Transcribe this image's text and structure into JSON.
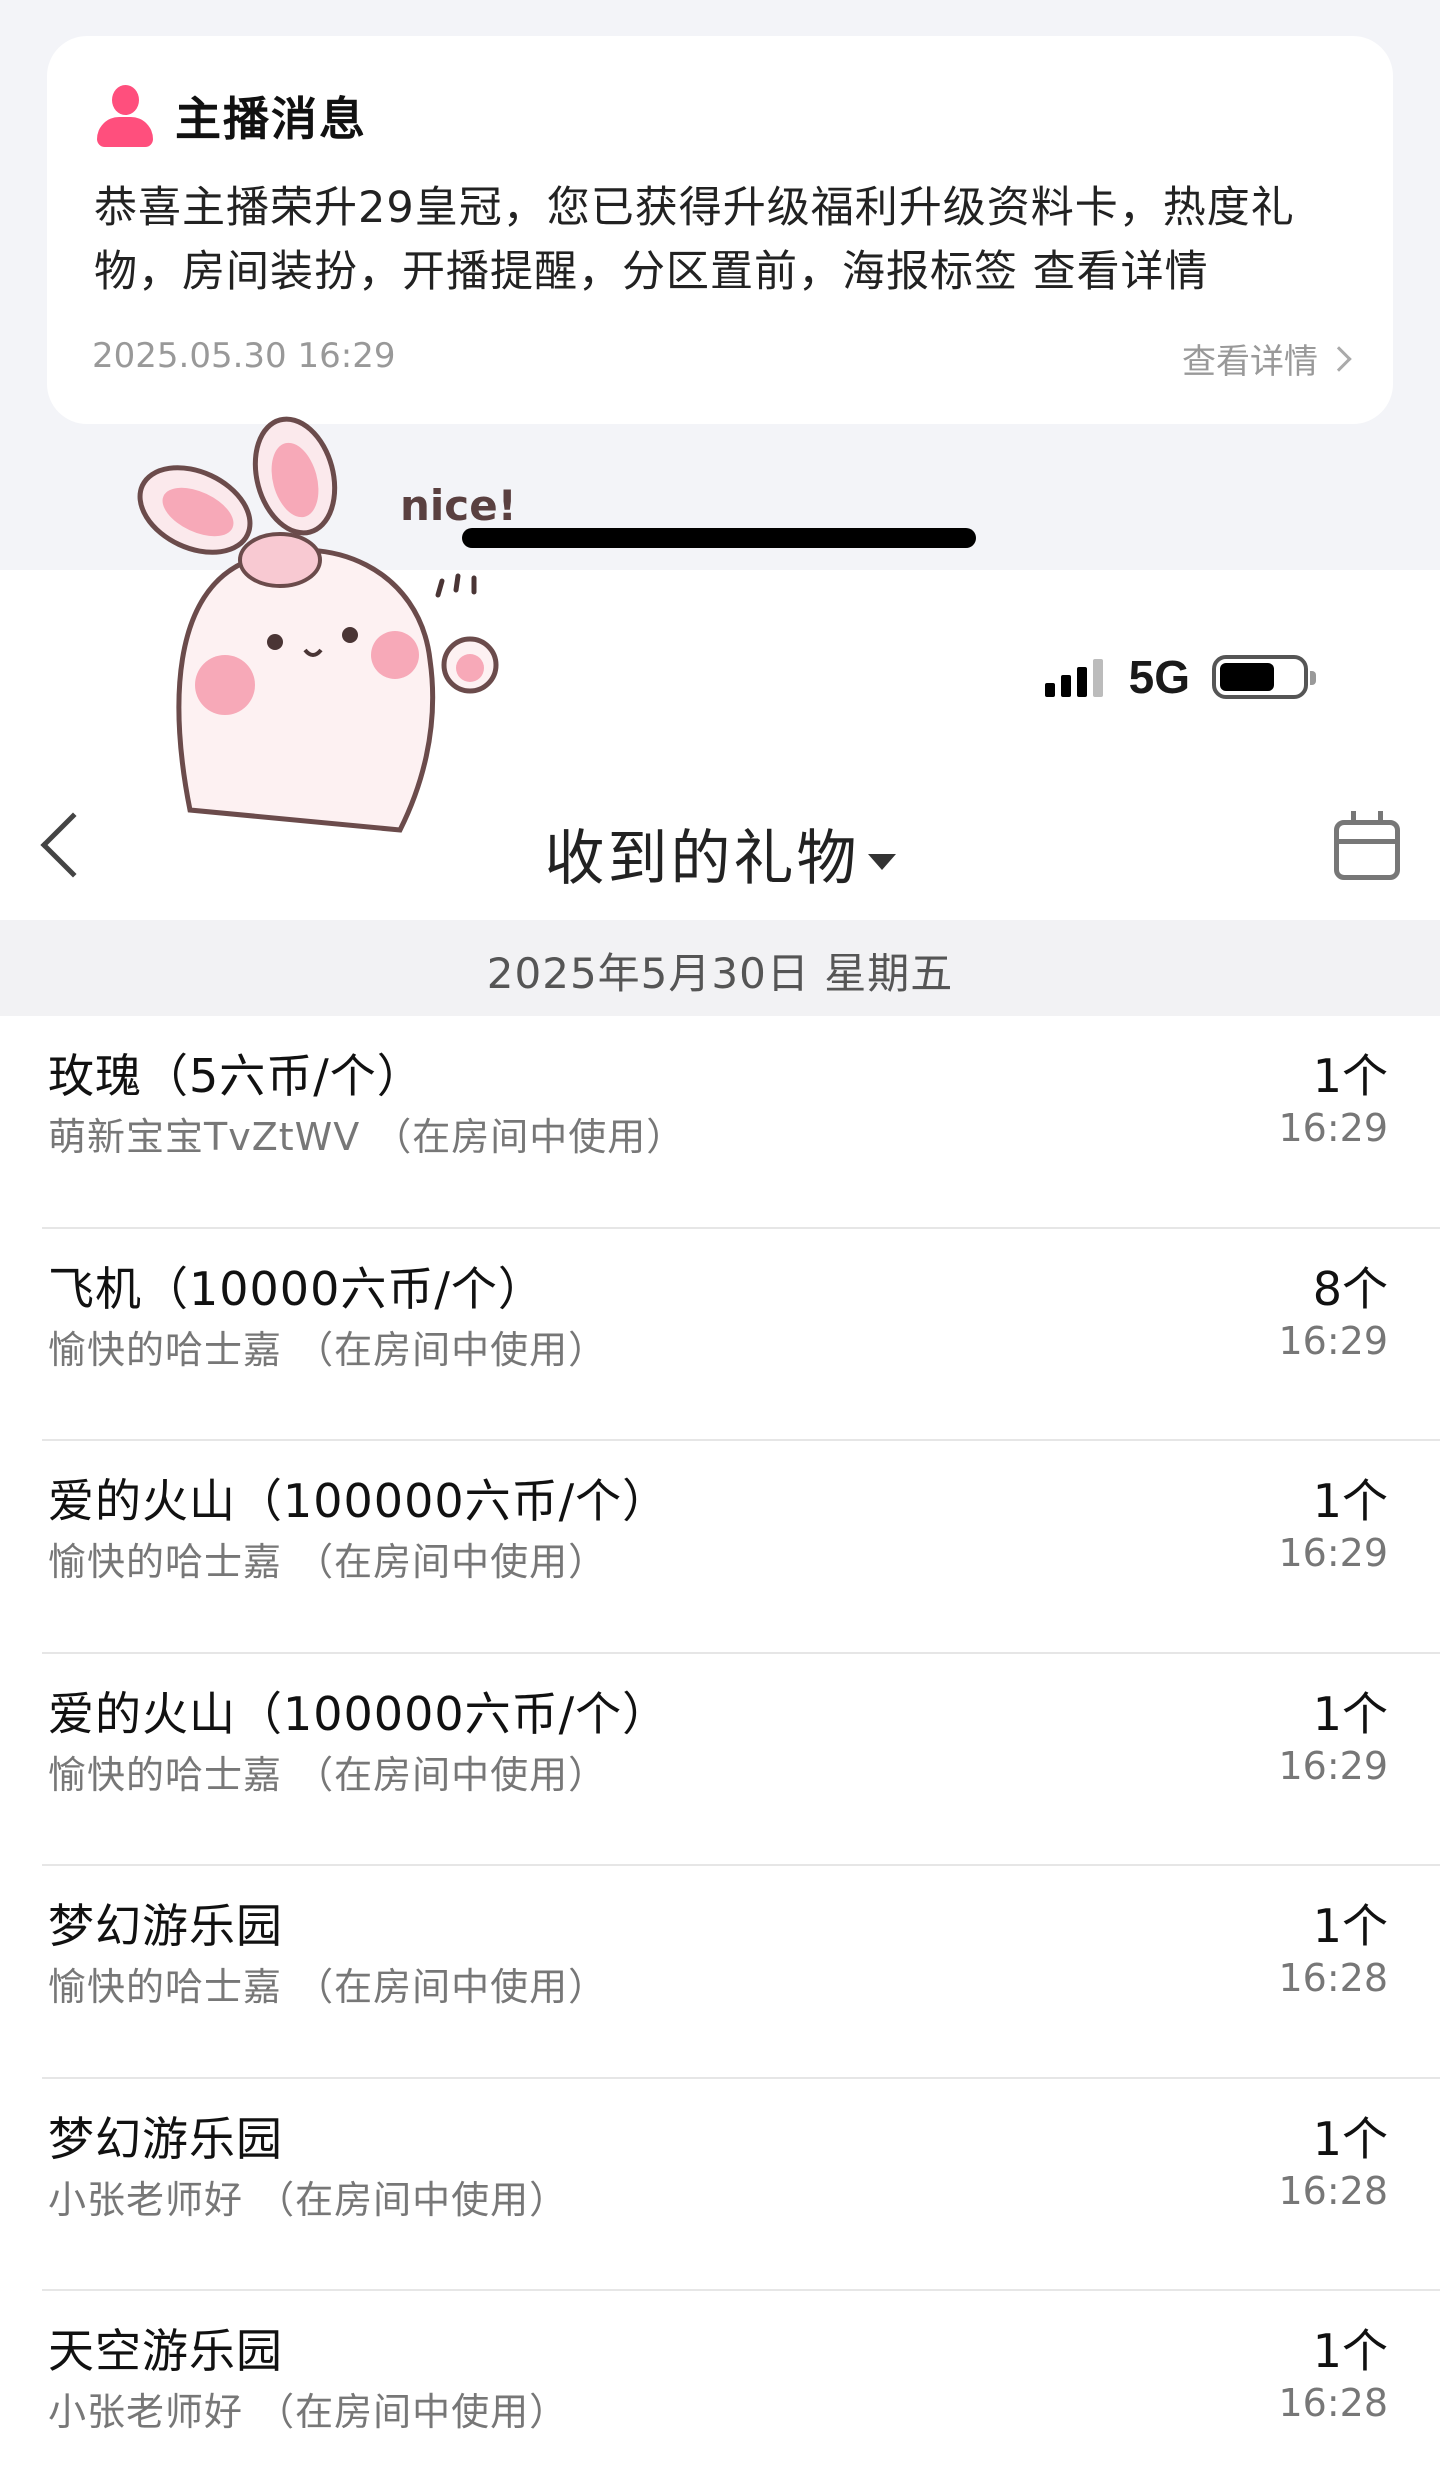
{
  "message": {
    "title": "主播消息",
    "body": "恭喜主播荣升29皇冠，您已获得升级福利升级资料卡，热度礼物，房间装扮，开播提醒，分区置前，海报标签 查看详情",
    "time": "2025.05.30 16:29",
    "detail_link": "查看详情"
  },
  "sticker": {
    "text": "nice!"
  },
  "status_bar": {
    "network": "5G"
  },
  "nav": {
    "title": "收到的礼物"
  },
  "date_header": "2025年5月30日 星期五",
  "gifts": [
    {
      "name": "玫瑰（5六币/个）",
      "sender": "萌新宝宝TvZtWV （在房间中使用）",
      "count": "1个",
      "time": "16:29"
    },
    {
      "name": "飞机（10000六币/个）",
      "sender": "愉快的哈士嘉 （在房间中使用）",
      "count": "8个",
      "time": "16:29"
    },
    {
      "name": "爱的火山（100000六币/个）",
      "sender": "愉快的哈士嘉 （在房间中使用）",
      "count": "1个",
      "time": "16:29"
    },
    {
      "name": "爱的火山（100000六币/个）",
      "sender": "愉快的哈士嘉 （在房间中使用）",
      "count": "1个",
      "time": "16:29"
    },
    {
      "name": "梦幻游乐园",
      "sender": "愉快的哈士嘉 （在房间中使用）",
      "count": "1个",
      "time": "16:28"
    },
    {
      "name": "梦幻游乐园",
      "sender": "小张老师好 （在房间中使用）",
      "count": "1个",
      "time": "16:28"
    },
    {
      "name": "天空游乐园",
      "sender": "小张老师好 （在房间中使用）",
      "count": "1个",
      "time": "16:28"
    }
  ],
  "colors": {
    "accent": "#ff4f7d",
    "band": "#f2f2f4",
    "muted": "#777777"
  }
}
